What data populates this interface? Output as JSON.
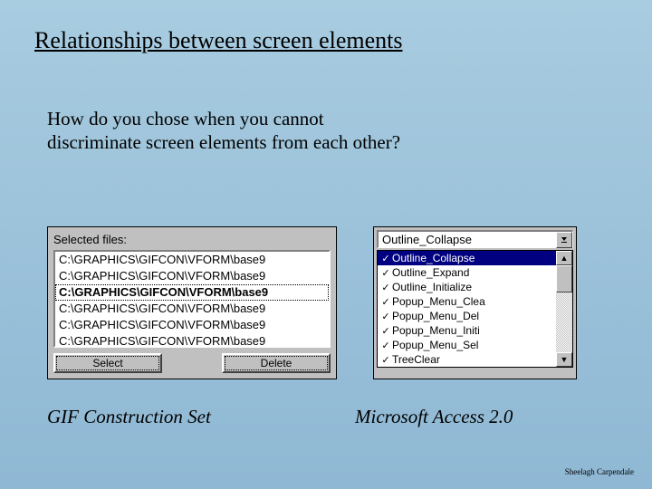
{
  "title": "Relationships between screen elements",
  "question_line1": "How do you chose when you cannot",
  "question_line2": "discriminate screen elements from each other?",
  "gif_panel": {
    "label": "Selected files:",
    "files": [
      "C:\\GRAPHICS\\GIFCON\\VFORM\\base9",
      "C:\\GRAPHICS\\GIFCON\\VFORM\\base9",
      "C:\\GRAPHICS\\GIFCON\\VFORM\\base9",
      "C:\\GRAPHICS\\GIFCON\\VFORM\\base9",
      "C:\\GRAPHICS\\GIFCON\\VFORM\\base9",
      "C:\\GRAPHICS\\GIFCON\\VFORM\\base9"
    ],
    "selected_index": 2,
    "select_btn": "Select",
    "delete_btn": "Delete"
  },
  "access_panel": {
    "combo_value": "Outline_Collapse",
    "items": [
      "Outline_Collapse",
      "Outline_Expand",
      "Outline_Initialize",
      "Popup_Menu_Clea",
      "Popup_Menu_Del",
      "Popup_Menu_Initi",
      "Popup_Menu_Sel",
      "TreeClear"
    ],
    "selected_index": 0
  },
  "captions": {
    "gif": "GIF Construction Set",
    "access": "Microsoft Access 2.0"
  },
  "footer": "Sheelagh Carpendale"
}
